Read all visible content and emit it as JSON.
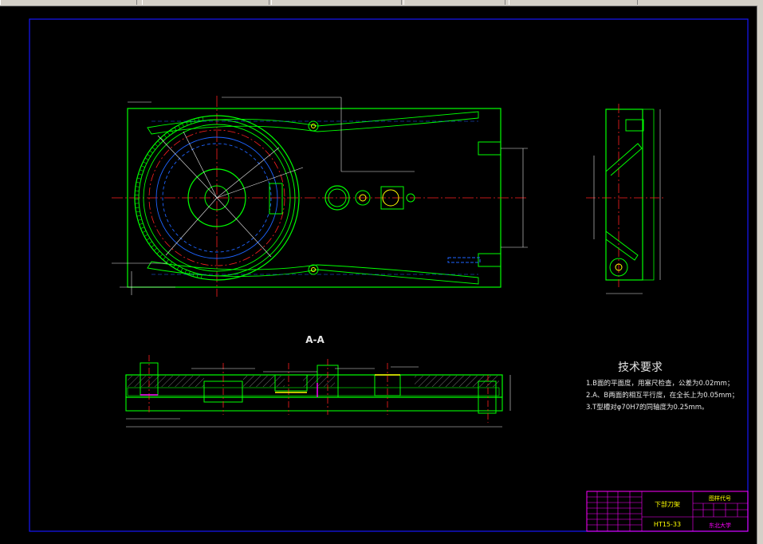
{
  "colors": {
    "background": "#000000",
    "frame": "#1414e6",
    "outline": "#00ff00",
    "dimension": "#e6e6e6",
    "center_line": "#ff2020",
    "hidden": "#4a6cff",
    "yellow": "#ffff00",
    "magenta": "#ff00ff",
    "cyan": "#00e5ee",
    "toolbar": "#d4d0c8"
  },
  "section_label": "A-A",
  "tech": {
    "title": "技术要求",
    "items": [
      "1.B面的平面度，用塞尺检查，公差为0.02mm；",
      "2.A、B两面的相互平行度，在全长上为0.05mm；",
      "3.T型槽对φ70H7的同轴度为0.25mm。"
    ]
  },
  "title_block": {
    "part_name": "下部刀架",
    "part_code": "HT15-33",
    "drawing_no": "图样代号",
    "company": "东北大学"
  }
}
